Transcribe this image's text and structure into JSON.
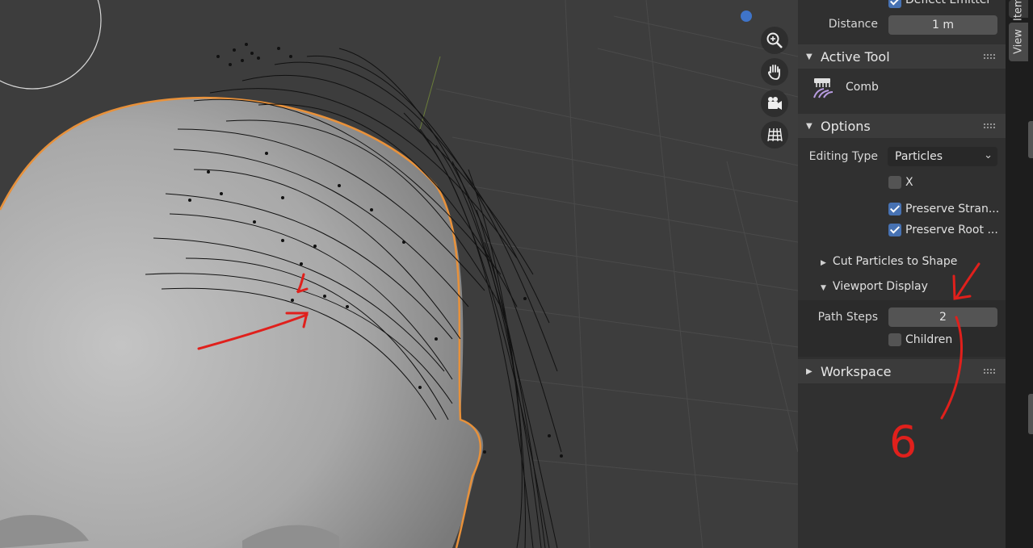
{
  "sidebar": {
    "top_partial_label": "Deflect Emitter",
    "distance_label": "Distance",
    "distance_value": "1 m",
    "active_tool": {
      "header": "Active Tool",
      "tool_name": "Comb"
    },
    "options": {
      "header": "Options",
      "editing_type_label": "Editing Type",
      "editing_type_value": "Particles",
      "mirror_x_label": "X",
      "mirror_x_checked": false,
      "preserve_strand_label": "Preserve Stran...",
      "preserve_strand_checked": true,
      "preserve_root_label": "Preserve Root ...",
      "preserve_root_checked": true,
      "cut_particles_label": "Cut Particles to Shape",
      "viewport_display_label": "Viewport Display",
      "path_steps_label": "Path Steps",
      "path_steps_value": "2",
      "children_label": "Children",
      "children_checked": false
    },
    "workspace": {
      "header": "Workspace"
    }
  },
  "tabs": [
    {
      "label": "Item"
    },
    {
      "label": "View"
    }
  ],
  "viewport": {
    "nav_buttons": [
      "zoom-icon",
      "hand-pan-icon",
      "camera-icon",
      "grid-ortho-icon"
    ],
    "annotation_number": "6",
    "colors": {
      "background": "#3d3d3d",
      "mesh": "#a9a9a9",
      "outline": "#e8913a",
      "annotation": "#e0201c"
    }
  },
  "colors": {
    "accent_blue": "#4772b3",
    "panel_bg": "#303030",
    "header_bg": "#3b3b3b"
  }
}
